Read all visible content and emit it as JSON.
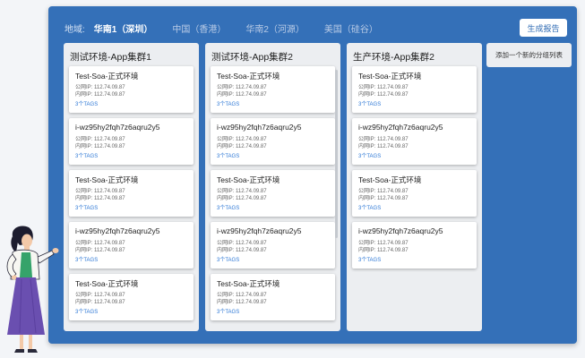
{
  "region_bar": {
    "label": "地域:",
    "tabs": [
      {
        "label": "华南1（深圳）",
        "active": true
      },
      {
        "label": "中国（香港）",
        "active": false
      },
      {
        "label": "华南2（河源）",
        "active": false
      },
      {
        "label": "美国（硅谷）",
        "active": false
      }
    ]
  },
  "toolbar": {
    "report_label": "生成报告"
  },
  "add_group_label": "添加一个新的分组列表",
  "columns": [
    {
      "title": "测试环境-App集群1",
      "cards": [
        {
          "name": "Test-Soa-正式环境",
          "public_ip": "公网IP:  112.74.09.87",
          "private_ip": "内网IP:  112.74.09.87",
          "tags": "3个TAGS"
        },
        {
          "name": "i-wz95hy2fqh7z6aqru2y5",
          "public_ip": "公网IP:  112.74.09.87",
          "private_ip": "内网IP:  112.74.09.87",
          "tags": "3个TAGS"
        },
        {
          "name": "Test-Soa-正式环境",
          "public_ip": "公网IP:  112.74.09.87",
          "private_ip": "内网IP:  112.74.09.87",
          "tags": "3个TAGS"
        },
        {
          "name": "i-wz95hy2fqh7z6aqru2y5",
          "public_ip": "公网IP:  112.74.09.87",
          "private_ip": "内网IP:  112.74.09.87",
          "tags": "3个TAGS"
        },
        {
          "name": "Test-Soa-正式环境",
          "public_ip": "公网IP:  112.74.09.87",
          "private_ip": "内网IP:  112.74.09.87",
          "tags": "3个TAGS"
        }
      ]
    },
    {
      "title": "测试环境-App集群2",
      "cards": [
        {
          "name": "Test-Soa-正式环境",
          "public_ip": "公网IP:  112.74.09.87",
          "private_ip": "内网IP:  112.74.09.87",
          "tags": "3个TAGS"
        },
        {
          "name": "i-wz95hy2fqh7z6aqru2y5",
          "public_ip": "公网IP:  112.74.09.87",
          "private_ip": "内网IP:  112.74.09.87",
          "tags": "3个TAGS"
        },
        {
          "name": "Test-Soa-正式环境",
          "public_ip": "公网IP:  112.74.09.87",
          "private_ip": "内网IP:  112.74.09.87",
          "tags": "3个TAGS"
        },
        {
          "name": "i-wz95hy2fqh7z6aqru2y5",
          "public_ip": "公网IP:  112.74.09.87",
          "private_ip": "内网IP:  112.74.09.87",
          "tags": "3个TAGS"
        },
        {
          "name": "Test-Soa-正式环境",
          "public_ip": "公网IP:  112.74.09.87",
          "private_ip": "内网IP:  112.74.09.87",
          "tags": "3个TAGS"
        }
      ]
    },
    {
      "title": "生产环境-App集群2",
      "cards": [
        {
          "name": "Test-Soa-正式环境",
          "public_ip": "公网IP:  112.74.09.87",
          "private_ip": "内网IP:  112.74.09.87",
          "tags": "3个TAGS"
        },
        {
          "name": "i-wz95hy2fqh7z6aqru2y5",
          "public_ip": "公网IP:  112.74.09.87",
          "private_ip": "内网IP:  112.74.09.87",
          "tags": "3个TAGS"
        },
        {
          "name": "Test-Soa-正式环境",
          "public_ip": "公网IP:  112.74.09.87",
          "private_ip": "内网IP:  112.74.09.87",
          "tags": "3个TAGS"
        },
        {
          "name": "i-wz95hy2fqh7z6aqru2y5",
          "public_ip": "公网IP:  112.74.09.87",
          "private_ip": "内网IP:  112.74.09.87",
          "tags": "3个TAGS"
        }
      ]
    }
  ],
  "colors": {
    "panel_bg": "#3470b8",
    "column_bg": "#eceef1",
    "tag_link": "#2e78d6",
    "button_text": "#2e6ab3"
  },
  "icons": [
    "woman-illustration"
  ]
}
